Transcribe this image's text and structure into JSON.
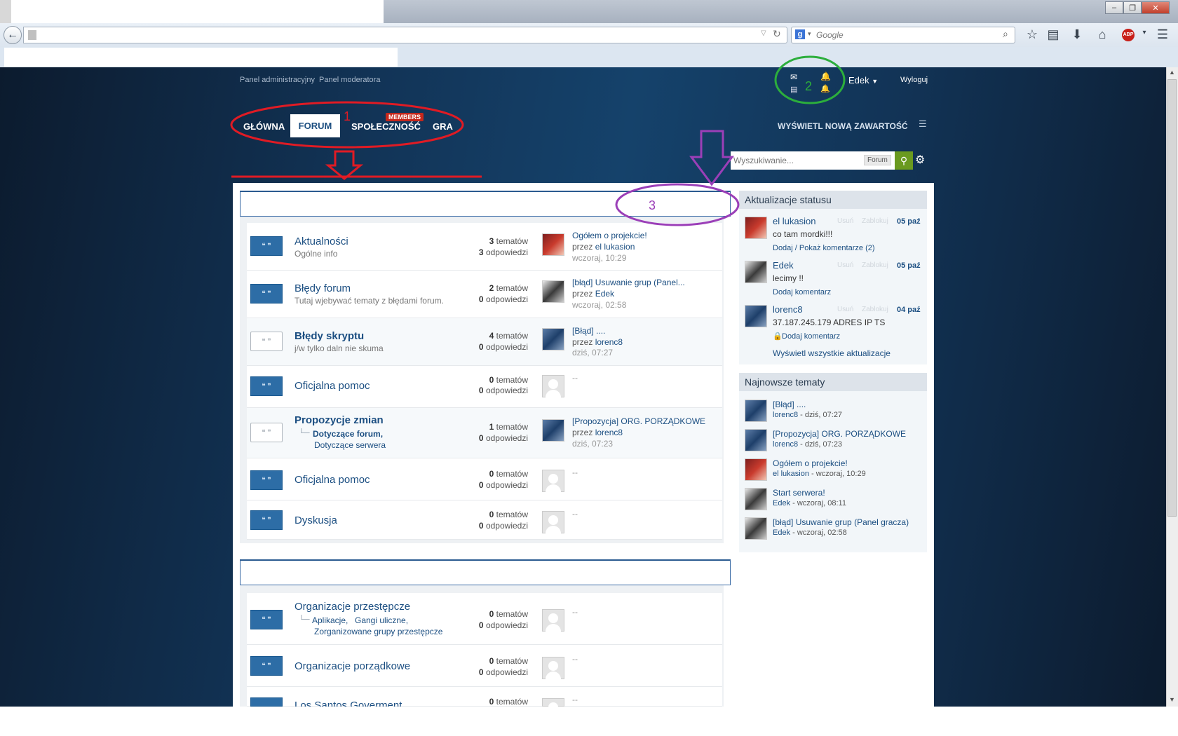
{
  "browser": {
    "search_placeholder": "Google",
    "window_controls": [
      "minimize",
      "maximize",
      "close"
    ]
  },
  "topbar": {
    "admin_panel": "Panel administracyjny",
    "mod_panel": "Panel moderatora",
    "username": "Edek",
    "logout": "Wyloguj"
  },
  "nav": {
    "items": [
      {
        "label": "GŁÓWNA"
      },
      {
        "label": "FORUM",
        "active": true
      },
      {
        "label": "SPOŁECZNOŚĆ",
        "badge": "MEMBERS"
      },
      {
        "label": "GRA"
      }
    ],
    "new_content": "WYŚWIETL NOWĄ ZAWARTOŚĆ"
  },
  "search": {
    "placeholder": "Wyszukiwanie...",
    "scope": "Forum"
  },
  "annotations": {
    "one": "1",
    "two": "2",
    "three": "3",
    "colors": {
      "red": "#e01b24",
      "green": "#2cae3c",
      "purple": "#9b3fb8"
    }
  },
  "forums": [
    {
      "title": "Aktualności",
      "desc": "Ogólne info",
      "topics": "3",
      "replies": "3",
      "topics_label": "tematów",
      "replies_label": "odpowiedzi",
      "last_title": "Ogółem o projekcie!",
      "last_by_prefix": "przez",
      "last_by": "el lukasion",
      "last_date": "wczoraj, 10:29",
      "avatar": "red"
    },
    {
      "title": "Błędy forum",
      "desc": "Tutaj wjebywać tematy z błędami forum.",
      "topics": "2",
      "replies": "0",
      "topics_label": "tematów",
      "replies_label": "odpowiedzi",
      "last_title": "[błąd] Usuwanie grup (Panel...",
      "last_by_prefix": "przez",
      "last_by": "Edek",
      "last_date": "wczoraj, 02:58",
      "avatar": "bw"
    },
    {
      "title": "Błędy skryptu",
      "desc": "j/w tylko daln nie skuma",
      "topics": "4",
      "replies": "0",
      "topics_label": "tematów",
      "replies_label": "odpowiedzi",
      "last_title": "[Błąd] ....",
      "last_by_prefix": "przez",
      "last_by": "lorenc8",
      "last_date": "dziś, 07:27",
      "avatar": "blue"
    },
    {
      "title": "Oficjalna pomoc",
      "topics": "0",
      "replies": "0",
      "topics_label": "tematów",
      "replies_label": "odpowiedzi",
      "last_none": "--"
    },
    {
      "title": "Propozycje zmian",
      "sub1": "Dotyczące forum,",
      "sub2": "Dotyczące serwera",
      "topics": "1",
      "replies": "0",
      "topics_label": "tematów",
      "replies_label": "odpowiedzi",
      "last_title": "[Propozycja] ORG. PORZĄDKOWE",
      "last_by_prefix": "przez",
      "last_by": "lorenc8",
      "last_date": "dziś, 07:23",
      "avatar": "blue"
    },
    {
      "title": "Oficjalna pomoc",
      "topics": "0",
      "replies": "0",
      "topics_label": "tematów",
      "replies_label": "odpowiedzi",
      "last_none": "--"
    },
    {
      "title": "Dyskusja",
      "topics": "0",
      "replies": "0",
      "topics_label": "tematów",
      "replies_label": "odpowiedzi",
      "last_none": "--"
    }
  ],
  "forums2": [
    {
      "title": "Organizacje przestępcze",
      "sub1": "Aplikacje,",
      "sub1b": "Gangi uliczne,",
      "sub2": "Zorganizowane grupy przestępcze",
      "topics": "0",
      "replies": "0",
      "topics_label": "tematów",
      "replies_label": "odpowiedzi",
      "last_none": "--"
    },
    {
      "title": "Organizacje porządkowe",
      "topics": "0",
      "replies": "0",
      "topics_label": "tematów",
      "replies_label": "odpowiedzi",
      "last_none": "--"
    },
    {
      "title": "Los Santos Goverment",
      "topics": "0",
      "topics_label": "tematów",
      "last_none": "--"
    }
  ],
  "status_updates": {
    "heading": "Aktualizacje statusu",
    "delete": "Usuń",
    "block": "Zablokuj",
    "items": [
      {
        "name": "el lukasion",
        "date": "05 paź",
        "text": "co tam mordki!!!",
        "link": "Dodaj / Pokaż komentarze (2)",
        "avatar": "red"
      },
      {
        "name": "Edek",
        "date": "05 paź",
        "text": "lecimy !!",
        "link": "Dodaj komentarz",
        "avatar": "bw"
      },
      {
        "name": "lorenc8",
        "date": "04 paź",
        "text": "37.187.245.179 ADRES IP TS",
        "link": "Dodaj komentarz",
        "avatar": "blue",
        "locked": true
      }
    ],
    "view_all": "Wyświetl wszystkie aktualizacje"
  },
  "latest_topics": {
    "heading": "Najnowsze tematy",
    "items": [
      {
        "title": "[Błąd] ....",
        "author": "lorenc8",
        "when": " - dziś, 07:27",
        "avatar": "blue"
      },
      {
        "title": "[Propozycja] ORG. PORZĄDKOWE",
        "author": "lorenc8",
        "when": " - dziś, 07:23",
        "avatar": "blue"
      },
      {
        "title": "Ogółem o projekcie!",
        "author": "el lukasion",
        "when": " - wczoraj, 10:29",
        "avatar": "red"
      },
      {
        "title": "Start serwera!",
        "author": "Edek",
        "when": " - wczoraj, 08:11",
        "avatar": "bw"
      },
      {
        "title": "[błąd] Usuwanie grup (Panel gracza)",
        "author": "Edek",
        "when": " - wczoraj, 02:58",
        "avatar": "bw"
      }
    ]
  }
}
